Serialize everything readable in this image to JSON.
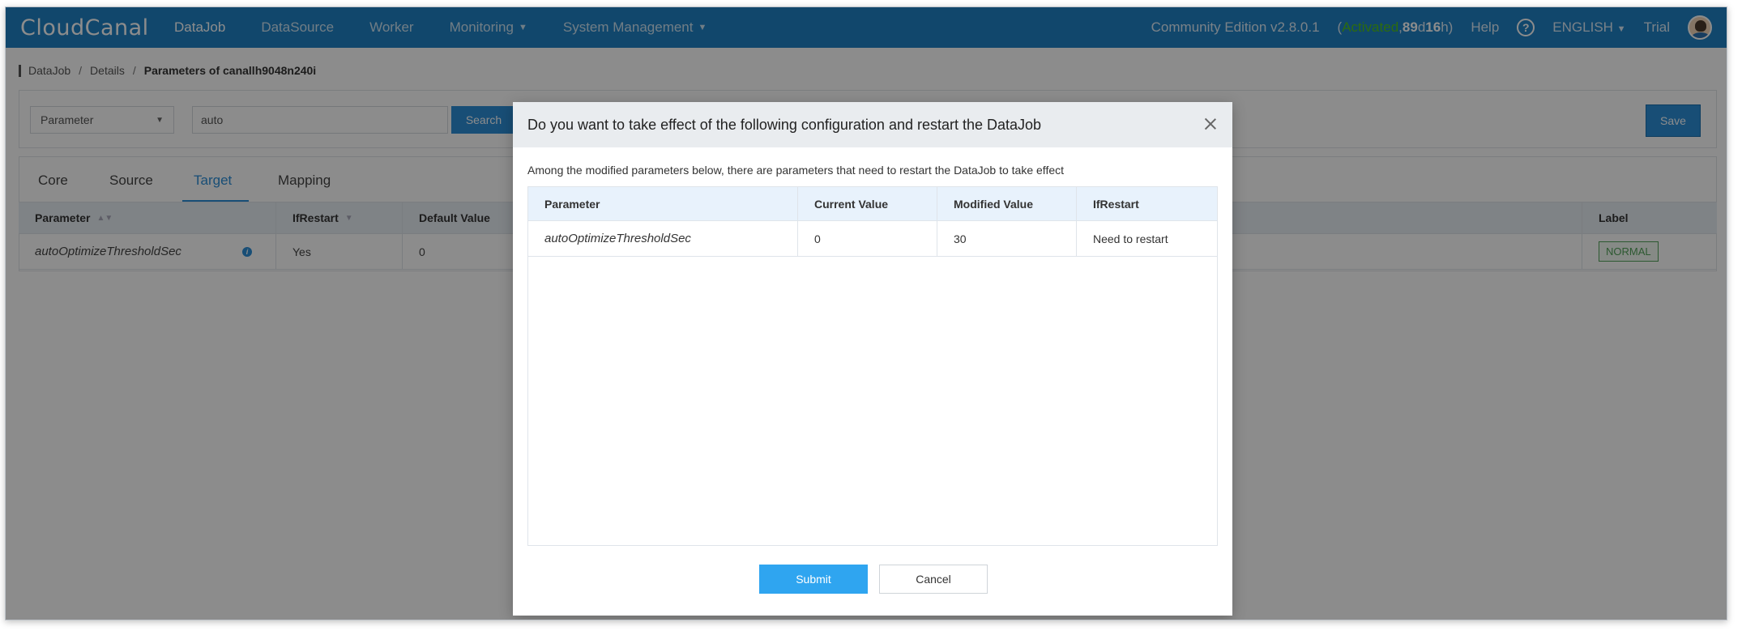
{
  "app": {
    "logo": "CloudCanal"
  },
  "nav": {
    "items": [
      {
        "label": "DataJob",
        "active": true,
        "dropdown": false
      },
      {
        "label": "DataSource",
        "active": false,
        "dropdown": false
      },
      {
        "label": "Worker",
        "active": false,
        "dropdown": false
      },
      {
        "label": "Monitoring",
        "active": false,
        "dropdown": true
      },
      {
        "label": "System Management",
        "active": false,
        "dropdown": true
      }
    ],
    "edition": "Community Edition v2.8.0.1",
    "status_open": "(",
    "status_activated": "Activated",
    "status_comma": ", ",
    "status_days": "89",
    "status_d": "d ",
    "status_hours": "16",
    "status_h": " h)",
    "help": "Help",
    "help_icon": "question-circle-icon",
    "language": "ENGLISH",
    "trial": "Trial"
  },
  "breadcrumb": {
    "items": [
      "DataJob",
      "Details"
    ],
    "separator": "/",
    "current": "Parameters of canallh9048n240i"
  },
  "filter": {
    "select_value": "Parameter",
    "search_value": "auto",
    "search_button": "Search",
    "save_button": "Save"
  },
  "tabs": [
    "Core",
    "Source",
    "Target",
    "Mapping"
  ],
  "active_tab": "Target",
  "bg_table": {
    "headers": [
      "Parameter",
      "IfRestart",
      "Default Value",
      "Label"
    ],
    "row": {
      "parameter": "autoOptimizeThresholdSec",
      "ifrestart": "Yes",
      "default": "0",
      "label": "NORMAL"
    }
  },
  "modal": {
    "title": "Do you want to take effect of the following configuration and restart the DataJob",
    "description": "Among the modified parameters below, there are parameters that need to restart the DataJob to take effect",
    "headers": [
      "Parameter",
      "Current Value",
      "Modified Value",
      "IfRestart"
    ],
    "rows": [
      {
        "parameter": "autoOptimizeThresholdSec",
        "current": "0",
        "modified": "30",
        "ifrestart": "Need to restart"
      }
    ],
    "submit": "Submit",
    "cancel": "Cancel"
  },
  "colors": {
    "nav_bg": "#1f81c5",
    "accent": "#2d8fd8",
    "activated": "#52c41a",
    "label_green": "#52a35a"
  }
}
